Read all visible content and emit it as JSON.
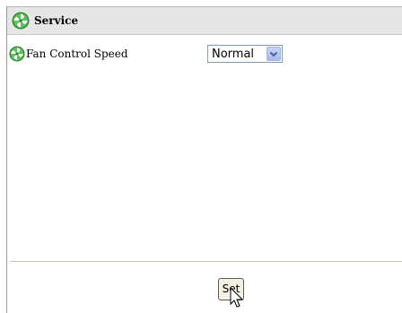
{
  "panel": {
    "title": "Service",
    "header_icon": "fan-icon"
  },
  "settings": {
    "fan_control": {
      "icon": "fan-icon",
      "label": "Fan Control Speed",
      "selected": "Normal"
    }
  },
  "actions": {
    "set_label": "Set"
  },
  "colors": {
    "header_bg": "#e6e6e6",
    "fan_green": "#3a9a3a",
    "divider": "#c8c0a8"
  }
}
